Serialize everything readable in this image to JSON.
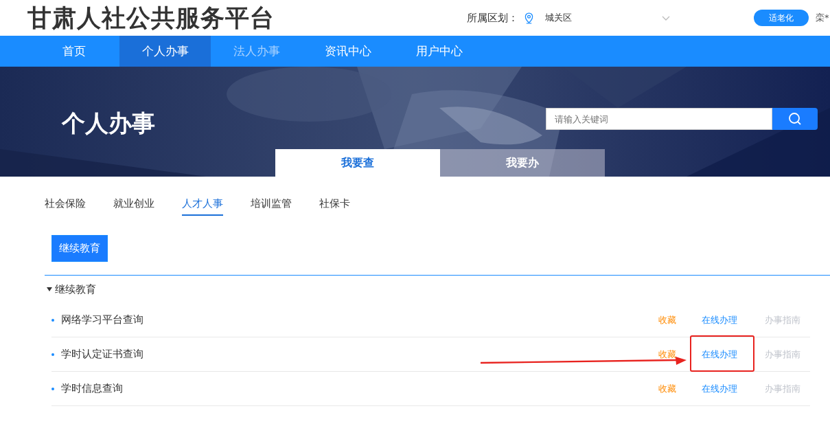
{
  "header": {
    "title": "甘肃人社公共服务平台",
    "region_label": "所属区划：",
    "region_value": "城关区",
    "elder_button": "适老化",
    "user": "栾*"
  },
  "nav": [
    {
      "label": "首页",
      "selected": false,
      "disabled": false
    },
    {
      "label": "个人办事",
      "selected": true,
      "disabled": false
    },
    {
      "label": "法人办事",
      "selected": false,
      "disabled": true
    },
    {
      "label": "资讯中心",
      "selected": false,
      "disabled": false
    },
    {
      "label": "用户中心",
      "selected": false,
      "disabled": false
    }
  ],
  "banner": {
    "title": "个人办事",
    "search": {
      "placeholder": "请输入关键词"
    },
    "tabs": [
      {
        "label": "我要查",
        "selected": true
      },
      {
        "label": "我要办",
        "selected": false
      }
    ]
  },
  "categories": [
    {
      "label": "社会保险",
      "selected": false
    },
    {
      "label": "就业创业",
      "selected": false
    },
    {
      "label": "人才人事",
      "selected": true
    },
    {
      "label": "培训监管",
      "selected": false
    },
    {
      "label": "社保卡",
      "selected": false
    }
  ],
  "subcategories": [
    {
      "label": "继续教育",
      "selected": true
    }
  ],
  "group": {
    "title": "继续教育",
    "expanded": true,
    "items": [
      {
        "name": "网络学习平台查询",
        "favorite": "收藏",
        "online": "在线办理",
        "guide": "办事指南",
        "highlighted": false
      },
      {
        "name": "学时认定证书查询",
        "favorite": "收藏",
        "online": "在线办理",
        "guide": "办事指南",
        "highlighted": true
      },
      {
        "name": "学时信息查询",
        "favorite": "收藏",
        "online": "在线办理",
        "guide": "办事指南",
        "highlighted": false
      }
    ]
  }
}
